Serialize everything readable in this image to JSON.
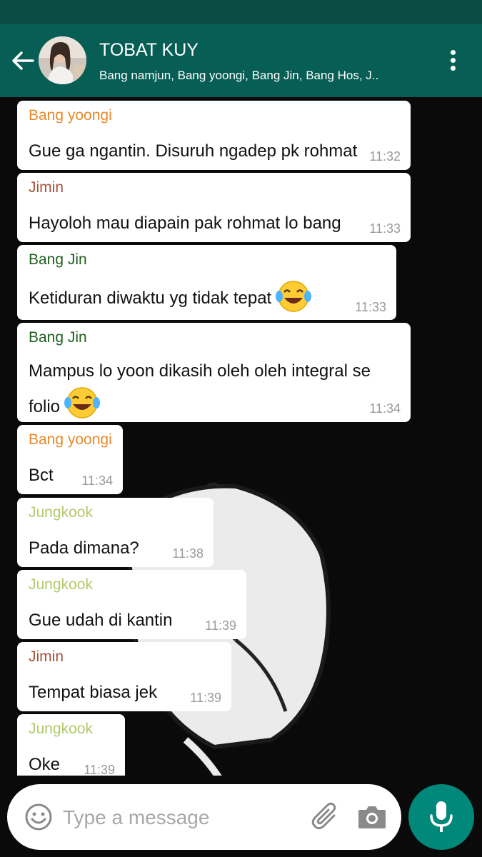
{
  "header": {
    "title": "TOBAT KUY",
    "subtitle": "Bang namjun, Bang yoongi, Bang Jin, Bang Hos, J.."
  },
  "messages": [
    {
      "sender": "Bang yoongi",
      "sender_color": "#e8892b",
      "text": "Gue ga ngantin. Disuruh ngadep pk rohmat",
      "time": "11:32"
    },
    {
      "sender": "Jimin",
      "sender_color": "#a8533a",
      "text": "Hayoloh mau diapain pak rohmat lo bang",
      "time": "11:33"
    },
    {
      "sender": "Bang Jin",
      "sender_color": "#1f5e1f",
      "text": "Ketiduran diwaktu yg tidak tepat",
      "emoji": "face-with-tears-of-joy",
      "time": "11:33"
    },
    {
      "sender": "Bang Jin",
      "sender_color": "#1f5e1f",
      "text": "Mampus lo yoon dikasih oleh oleh integral se folio",
      "emoji": "face-with-tears-of-joy",
      "time": "11:34"
    },
    {
      "sender": "Bang yoongi",
      "sender_color": "#e8892b",
      "text": "Bct",
      "time": "11:34"
    },
    {
      "sender": "Jungkook",
      "sender_color": "#b3c96b",
      "text": "Pada dimana?",
      "time": "11:38"
    },
    {
      "sender": "Jungkook",
      "sender_color": "#b3c96b",
      "text": "Gue udah di kantin",
      "time": "11:39"
    },
    {
      "sender": "Jimin",
      "sender_color": "#a8533a",
      "text": "Tempat biasa jek",
      "time": "11:39"
    },
    {
      "sender": "Jungkook",
      "sender_color": "#b3c96b",
      "text": "Oke",
      "time": "11:39"
    }
  ],
  "composer": {
    "placeholder": "Type a message"
  },
  "colors": {
    "header_bg": "#075e54",
    "status_bar_bg": "#0a4d43",
    "mic_button": "#00897b",
    "wallpaper": "#0a0a0a"
  }
}
